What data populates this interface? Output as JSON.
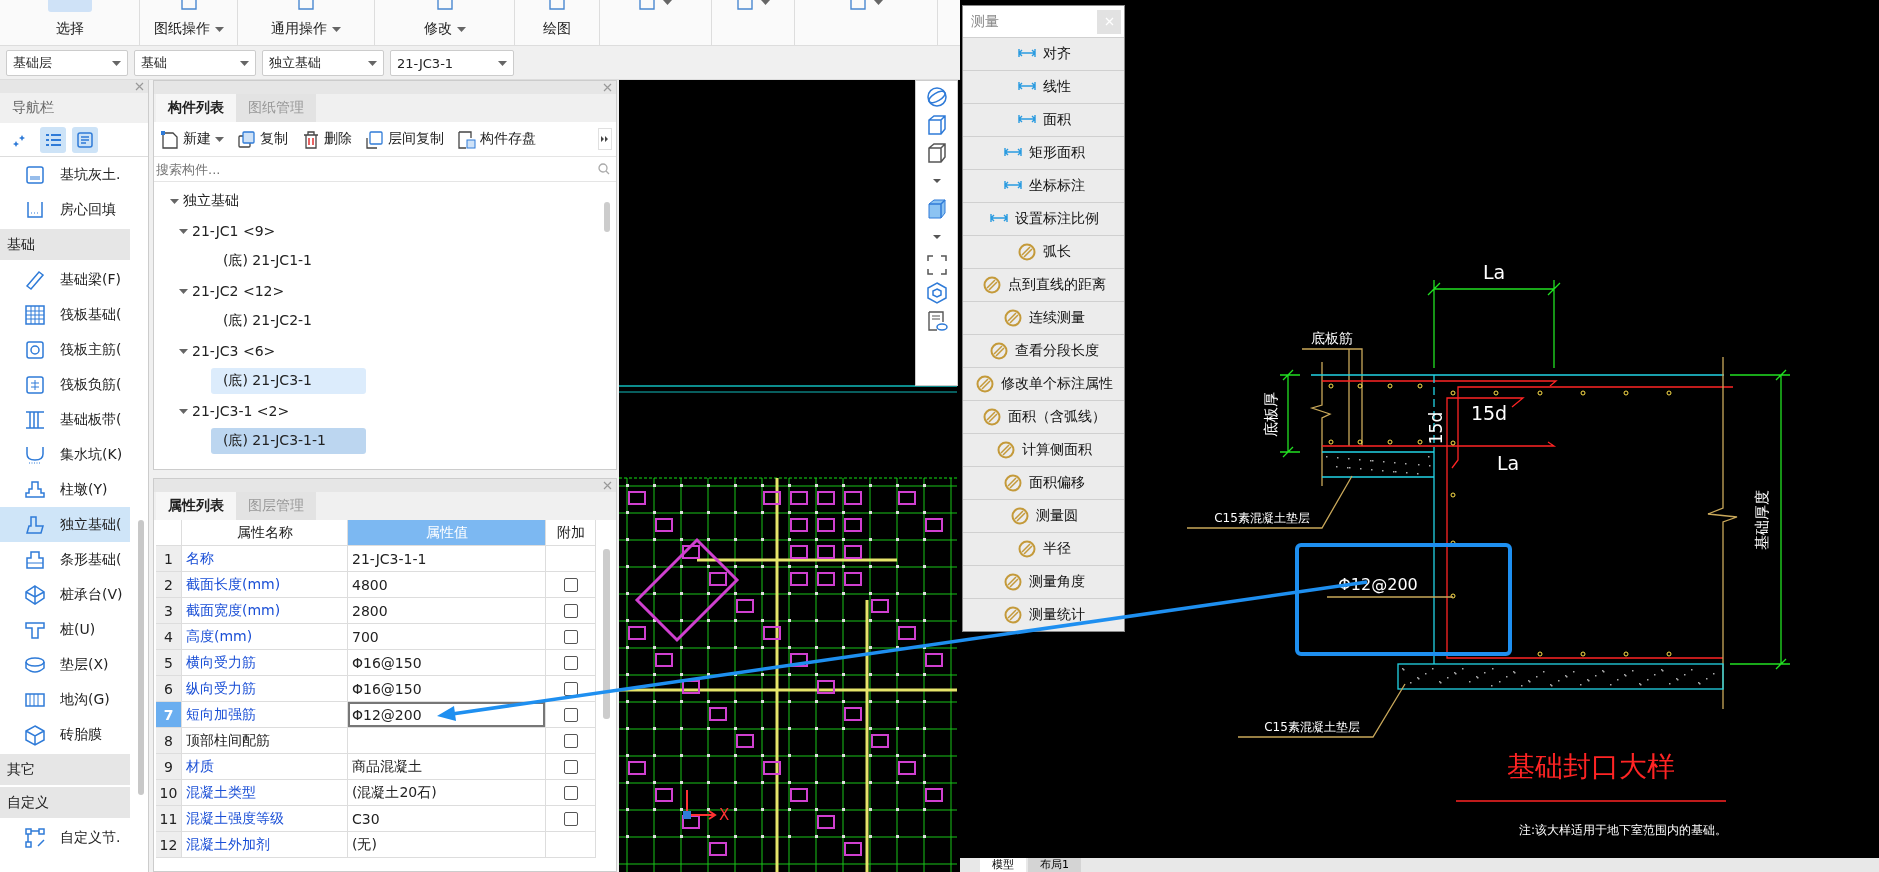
{
  "ribbon": {
    "groups": [
      {
        "label": "选择",
        "dropdown": false,
        "selected": true
      },
      {
        "label": "图纸操作",
        "dropdown": true,
        "selected": false
      },
      {
        "label": "通用操作",
        "dropdown": true,
        "selected": false
      },
      {
        "label": "修改",
        "dropdown": true,
        "selected": false
      },
      {
        "label": "绘图",
        "dropdown": false,
        "selected": false
      },
      {
        "dropdown": true,
        "selected": false
      },
      {
        "dropdown": true,
        "selected": false
      },
      {
        "dropdown": true,
        "selected": false
      }
    ]
  },
  "filters": [
    {
      "value": "基础层"
    },
    {
      "value": "基础"
    },
    {
      "value": "独立基础"
    },
    {
      "value": "21-JC3-1"
    }
  ],
  "navigation": {
    "title": "导航栏",
    "view_buttons": [
      {
        "selected": false
      },
      {
        "selected": true
      },
      {
        "selected": true
      }
    ],
    "items": [
      {
        "kind": "item",
        "label": "基坑灰土.",
        "selected": false
      },
      {
        "kind": "item",
        "label": "房心回填",
        "selected": false
      },
      {
        "kind": "section",
        "label": "基础"
      },
      {
        "kind": "item",
        "label": "基础梁(F)",
        "selected": false
      },
      {
        "kind": "item",
        "label": "筏板基础(",
        "selected": false
      },
      {
        "kind": "item",
        "label": "筏板主筋(",
        "selected": false
      },
      {
        "kind": "item",
        "label": "筏板负筋(",
        "selected": false
      },
      {
        "kind": "item",
        "label": "基础板带(",
        "selected": false
      },
      {
        "kind": "item",
        "label": "集水坑(K)",
        "selected": false
      },
      {
        "kind": "item",
        "label": "柱墩(Y)",
        "selected": false
      },
      {
        "kind": "item",
        "label": "独立基础(",
        "selected": true
      },
      {
        "kind": "item",
        "label": "条形基础(",
        "selected": false
      },
      {
        "kind": "item",
        "label": "桩承台(V)",
        "selected": false
      },
      {
        "kind": "item",
        "label": "桩(U)",
        "selected": false
      },
      {
        "kind": "item",
        "label": "垫层(X)",
        "selected": false
      },
      {
        "kind": "item",
        "label": "地沟(G)",
        "selected": false
      },
      {
        "kind": "item",
        "label": "砖胎膜",
        "selected": false
      },
      {
        "kind": "section",
        "label": "其它"
      },
      {
        "kind": "section",
        "label": "自定义"
      },
      {
        "kind": "item",
        "label": "自定义节.",
        "selected": false
      }
    ]
  },
  "component_panel": {
    "tabs": [
      {
        "label": "构件列表",
        "selected": true
      },
      {
        "label": "图纸管理",
        "selected": false
      }
    ],
    "toolbar": [
      {
        "label": "新建",
        "dropdown": true
      },
      {
        "label": "复制",
        "dropdown": false
      },
      {
        "label": "删除",
        "dropdown": false
      },
      {
        "label": "层间复制",
        "dropdown": false
      },
      {
        "label": "构件存盘",
        "dropdown": false
      }
    ],
    "search": {
      "placeholder": "搜索构件..."
    },
    "tree": [
      {
        "label": "独立基础",
        "expanded": true,
        "children": [
          {
            "label": "21-JC1 <9>",
            "expanded": true,
            "children": [
              {
                "label": "(底) 21-JC1-1",
                "selected": false,
                "highlighted": false
              }
            ]
          },
          {
            "label": "21-JC2 <12>",
            "expanded": true,
            "children": [
              {
                "label": "(底) 21-JC2-1",
                "selected": false,
                "highlighted": false
              }
            ]
          },
          {
            "label": "21-JC3 <6>",
            "expanded": true,
            "children": [
              {
                "label": "(底) 21-JC3-1",
                "selected": false,
                "highlighted": true
              }
            ]
          },
          {
            "label": "21-JC3-1 <2>",
            "expanded": true,
            "children": [
              {
                "label": "(底) 21-JC3-1-1",
                "selected": true,
                "highlighted": false
              }
            ]
          }
        ]
      }
    ]
  },
  "property_panel": {
    "tabs": [
      {
        "label": "属性列表",
        "selected": true
      },
      {
        "label": "图层管理",
        "selected": false
      }
    ],
    "columns": [
      {
        "label": "属性名称",
        "selected": false
      },
      {
        "label": "属性值",
        "selected": true
      },
      {
        "label": "附加",
        "selected": false
      }
    ],
    "rows": [
      {
        "index": "1",
        "name": "名称",
        "value": "21-JC3-1-1",
        "public": true,
        "selected": false
      },
      {
        "index": "2",
        "name": "截面长度(mm)",
        "value": "4800",
        "public": true,
        "selected": false,
        "extra": {
          "checked": false
        }
      },
      {
        "index": "3",
        "name": "截面宽度(mm)",
        "value": "2800",
        "public": true,
        "selected": false,
        "extra": {
          "checked": false
        }
      },
      {
        "index": "4",
        "name": "高度(mm)",
        "value": "700",
        "public": true,
        "selected": false,
        "extra": {
          "checked": false
        }
      },
      {
        "index": "5",
        "name": "横向受力筋",
        "value": "Φ16@150",
        "public": true,
        "selected": false,
        "extra": {
          "checked": false
        }
      },
      {
        "index": "6",
        "name": "纵向受力筋",
        "value": "Φ16@150",
        "public": true,
        "selected": false,
        "extra": {
          "checked": false
        }
      },
      {
        "index": "7",
        "name": "短向加强筋",
        "value": "Φ12@200",
        "public": true,
        "selected": true,
        "extra": {
          "checked": false
        }
      },
      {
        "index": "8",
        "name": "顶部柱间配筋",
        "public": false,
        "selected": false,
        "extra": {
          "checked": false
        }
      },
      {
        "index": "9",
        "name": "材质",
        "value": "商品混凝土",
        "public": true,
        "selected": false,
        "extra": {
          "checked": false
        }
      },
      {
        "index": "10",
        "name": "混凝土类型",
        "value": "(混凝土20石)",
        "public": true,
        "selected": false,
        "extra": {
          "checked": false
        }
      },
      {
        "index": "11",
        "name": "混凝土强度等级",
        "value": "C30",
        "public": true,
        "selected": false,
        "extra": {
          "checked": false
        }
      },
      {
        "index": "12",
        "name": "混凝土外加剂",
        "value": "(无)",
        "public": true,
        "selected": false
      }
    ]
  },
  "plan_view": {
    "axis_label": "X"
  },
  "measure_panel": {
    "title": "测量",
    "items": [
      {
        "label": "对齐",
        "kind": "annotate"
      },
      {
        "label": "线性",
        "kind": "annotate"
      },
      {
        "label": "面积",
        "kind": "annotate"
      },
      {
        "label": "矩形面积",
        "kind": "annotate"
      },
      {
        "label": "坐标标注",
        "kind": "annotate"
      },
      {
        "label": "设置标注比例",
        "kind": "annotate"
      },
      {
        "label": "弧长",
        "kind": "measure"
      },
      {
        "label": "点到直线的距离",
        "kind": "measure"
      },
      {
        "label": "连续测量",
        "kind": "measure"
      },
      {
        "label": "查看分段长度",
        "kind": "measure"
      },
      {
        "label": "修改单个标注属性",
        "kind": "measure"
      },
      {
        "label": "面积（含弧线）",
        "kind": "measure"
      },
      {
        "label": "计算侧面积",
        "kind": "measure"
      },
      {
        "label": "面积偏移",
        "kind": "measure"
      },
      {
        "label": "测量圆",
        "kind": "measure"
      },
      {
        "label": "半径",
        "kind": "measure"
      },
      {
        "label": "测量角度",
        "kind": "measure"
      },
      {
        "label": "测量统计",
        "kind": "measure"
      }
    ]
  },
  "detail_drawing": {
    "top_dimension": "La",
    "bottom_bar_label": "底板筋",
    "slab_thickness": "底板厚",
    "vertical_anchor": "15d",
    "horizontal_anchor": "15d",
    "anchor_length": "La",
    "upper_cushion": "C15素混凝土垫层",
    "lower_cushion": "C15素混凝土垫层",
    "foundation_thickness": "基础厚度",
    "rebar_spec": "Φ12@200",
    "title": "基础封口大样",
    "note": "注:该大样适用于地下室范围内的基础。"
  },
  "layout_tabs": [
    {
      "label": "模型",
      "selected": true
    },
    {
      "label": "布局1",
      "selected": false
    }
  ]
}
